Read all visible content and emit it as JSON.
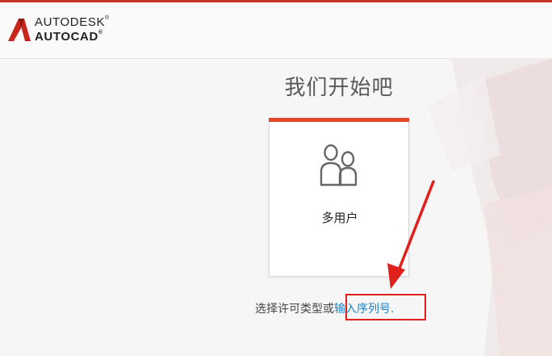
{
  "header": {
    "brand_line1": "AUTODESK",
    "brand_line2": "AUTOCAD",
    "registered_mark": "®",
    "logo_icon": "autodesk-a-logo"
  },
  "main": {
    "title": "我们开始吧",
    "license_card": {
      "label": "多用户",
      "icon": "multi-user-icon",
      "accent_color": "#e2472a"
    },
    "prompt_text": "选择许可类型或",
    "serial_link": "输入序列号."
  },
  "annotation": {
    "highlight_color": "#e0211b"
  }
}
